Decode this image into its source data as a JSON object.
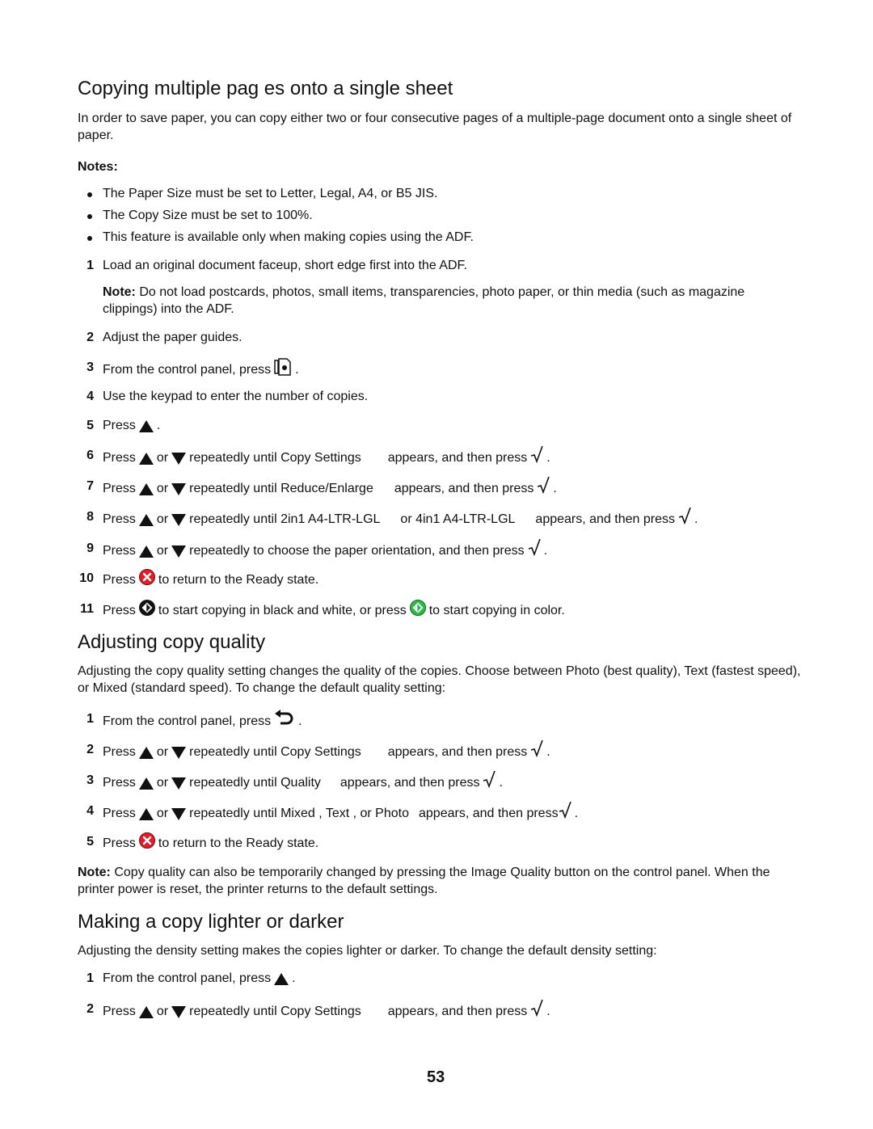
{
  "section1": {
    "title": "Copying multiple pag   es onto a single sheet",
    "intro": "In order to save paper, you can copy either two or four consecutive pages of a multiple-page document onto a single sheet of paper.",
    "notes_label": "Notes:",
    "notes": [
      "The Paper Size must be set to Letter, Legal, A4, or B5 JIS.",
      "The Copy Size must be set to 100%.",
      "This feature is available only when making copies using the ADF."
    ],
    "steps": [
      {
        "num": "1",
        "text": "Load an original document faceup, short edge first into the ADF."
      },
      {
        "num": "2",
        "text": "Adjust the paper guides."
      },
      {
        "num": "3",
        "pre": "From the control panel, press",
        "icon": "copy-icon",
        "post": "."
      },
      {
        "num": "4",
        "text": "Use the keypad to enter the number of copies."
      },
      {
        "num": "5",
        "pre": "Press",
        "icon": "up-arrow-icon",
        "post": "."
      },
      {
        "num": "6",
        "a": "Press",
        "or": "or",
        "b": "repeatedly until Copy Settings",
        "c": "appears, and then press",
        "post": "."
      },
      {
        "num": "7",
        "a": "Press",
        "or": "or",
        "b": "repeatedly until Reduce/Enlarge",
        "c": "appears, and then press",
        "post": "."
      },
      {
        "num": "8",
        "a": "Press",
        "or": "or",
        "b": "repeatedly until 2in1 A4-LTR-LGL",
        "b2": "or 4in1 A4-LTR-LGL",
        "c": "appears, and then press",
        "post": "."
      },
      {
        "num": "9",
        "a": "Press",
        "or": "or",
        "b": "repeatedly to choose the paper orientation, and then press",
        "post": "."
      },
      {
        "num": "10",
        "pre": "Press",
        "post": "to return to the Ready  state."
      },
      {
        "num": "11",
        "pre": "Press",
        "mid": "to start copying in black and white, or press",
        "post": "to start copying in color."
      }
    ],
    "step1_note_label": "Note:",
    "step1_note": "Do not load postcards, photos, small items, transparencies, photo paper, or thin media (such as magazine clippings) into the ADF."
  },
  "section2": {
    "title": "Adjusting copy quality",
    "intro": "Adjusting the copy quality setting changes the quality of the copies. Choose between Photo (best quality), Text (fastest speed), or Mixed (standard speed). To change the default quality setting:",
    "steps": [
      {
        "num": "1",
        "pre": "From the control panel, press",
        "post": "."
      },
      {
        "num": "2",
        "a": "Press",
        "or": "or",
        "b": "repeatedly until Copy Settings",
        "c": "appears, and then press",
        "post": "."
      },
      {
        "num": "3",
        "a": "Press",
        "or": "or",
        "b": "repeatedly until Quality",
        "c": "appears, and then press",
        "post": "."
      },
      {
        "num": "4",
        "a": "Press",
        "or": "or",
        "b": "repeatedly until Mixed , Text  , or Photo",
        "c": "appears, and then press",
        "post": "."
      },
      {
        "num": "5",
        "pre": "Press",
        "post": "to return to the Ready  state."
      }
    ],
    "note_label": "Note:",
    "note": "Copy quality can also be temporarily changed by pressing the Image Quality button on the control panel. When the printer power is reset, the printer returns to the default settings."
  },
  "section3": {
    "title": "Making a copy lighter or darker",
    "intro": "Adjusting the density setting makes the copies lighter or darker. To change the default density setting:",
    "steps": [
      {
        "num": "1",
        "pre": "From the control panel, press",
        "post": "."
      },
      {
        "num": "2",
        "a": "Press",
        "or": "or",
        "b": "repeatedly until Copy Settings",
        "c": "appears, and then press",
        "post": "."
      }
    ]
  },
  "page_number": "53",
  "colors": {
    "stop_red": "#e01e2b",
    "start_green": "#2db84a",
    "text": "#111111"
  }
}
